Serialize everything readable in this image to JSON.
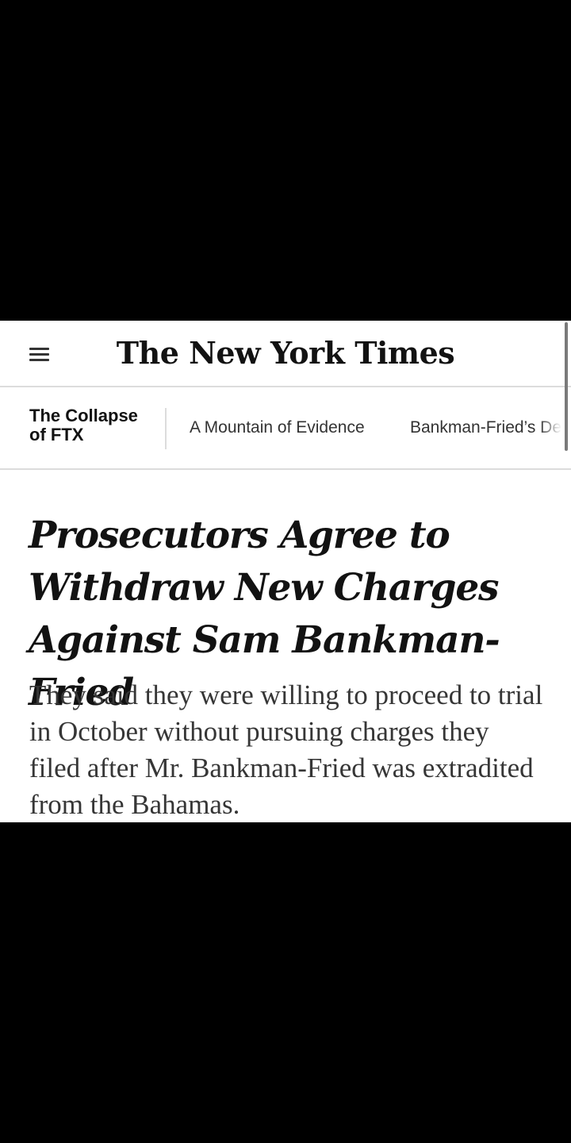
{
  "masthead": {
    "logo_text": "The New York Times",
    "menu_icon": "hamburger-menu-icon"
  },
  "story_nav": {
    "title": "The Collapse of FTX",
    "links": [
      "A Mountain of Evidence",
      "Bankman-Fried’s De"
    ]
  },
  "article": {
    "headline": "Prosecutors Agree to Withdraw New Charges Against Sam Bankman-Fried",
    "summary": "They said they were willing to proceed to trial in October without pursuing charges they filed after Mr. Bankman-Fried was extradited from the Bahamas."
  }
}
